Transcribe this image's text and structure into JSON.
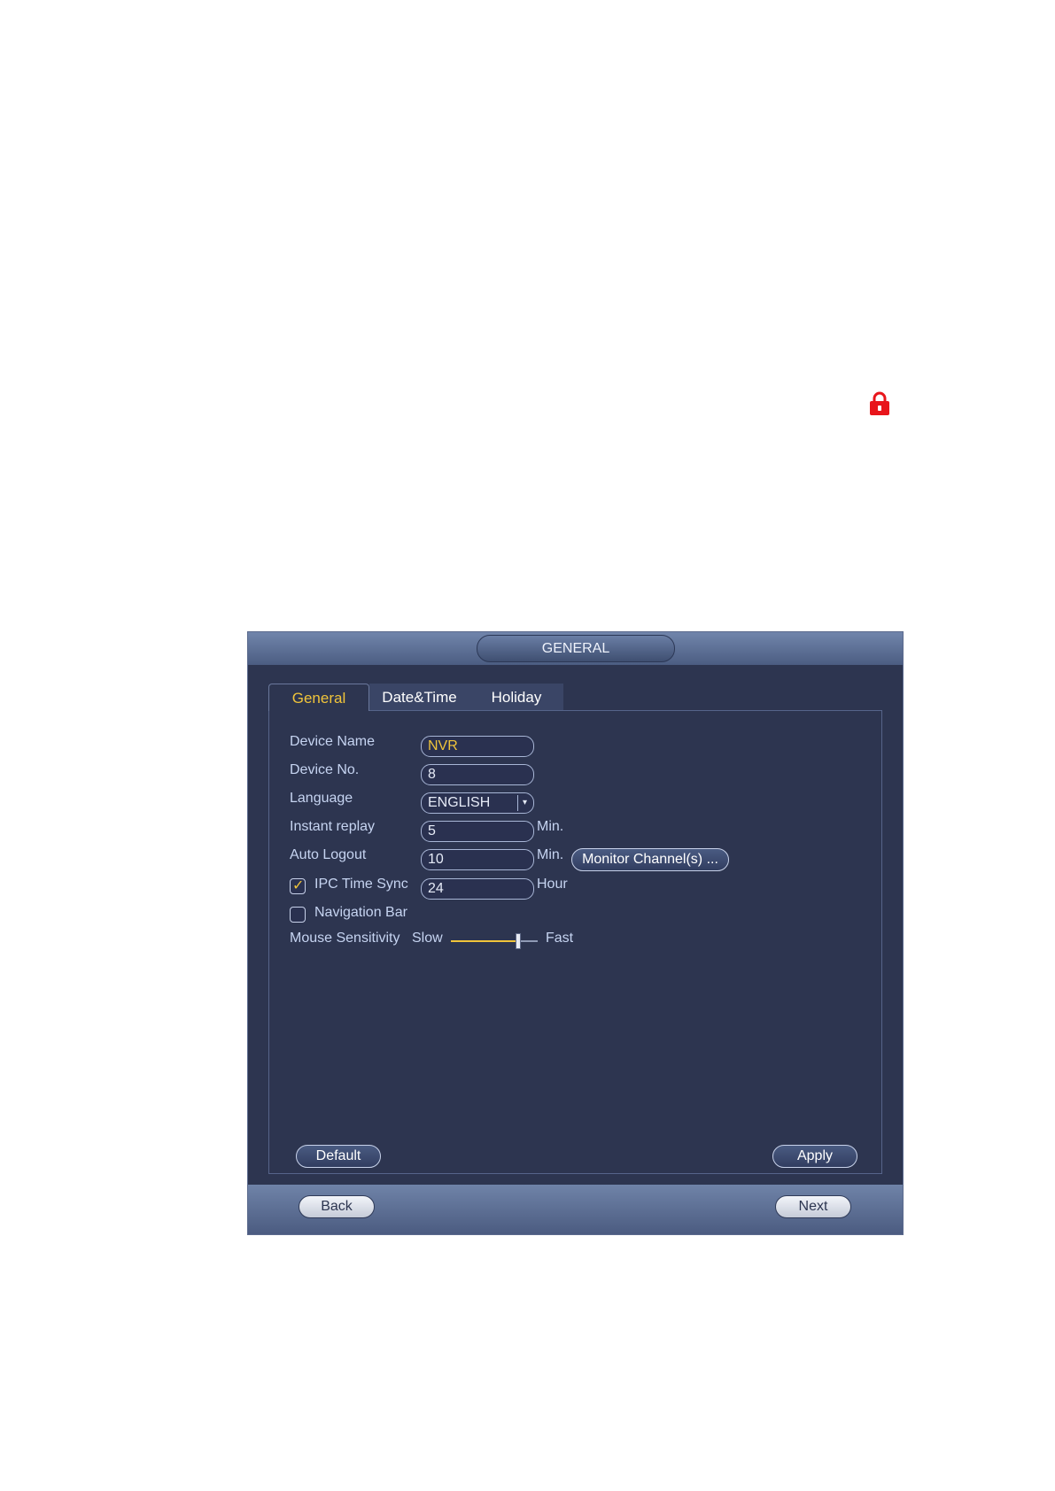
{
  "window": {
    "title": "GENERAL"
  },
  "tabs": [
    {
      "label": "General",
      "active": true
    },
    {
      "label": "Date&Time",
      "active": false
    },
    {
      "label": "Holiday",
      "active": false
    }
  ],
  "form": {
    "device_name": {
      "label": "Device Name",
      "value": "NVR"
    },
    "device_no": {
      "label": "Device No.",
      "value": "8"
    },
    "language": {
      "label": "Language",
      "value": "ENGLISH"
    },
    "instant_replay": {
      "label": "Instant replay",
      "value": "5",
      "unit": "Min."
    },
    "auto_logout": {
      "label": "Auto Logout",
      "value": "10",
      "unit": "Min.",
      "button": "Monitor Channel(s) ..."
    },
    "ipc_time_sync": {
      "label": "IPC Time Sync",
      "checked": true,
      "value": "24",
      "unit": "Hour"
    },
    "navigation_bar": {
      "label": "Navigation Bar",
      "checked": false
    },
    "mouse_sensitivity": {
      "label": "Mouse Sensitivity",
      "min_label": "Slow",
      "max_label": "Fast",
      "level": 0.78
    }
  },
  "buttons": {
    "default": "Default",
    "apply": "Apply",
    "back": "Back",
    "next": "Next"
  },
  "colors": {
    "accent": "#f0c43a",
    "lock": "#e8151b",
    "window_bg": "#2d3550"
  },
  "icons": {
    "lock": "lock-icon"
  }
}
